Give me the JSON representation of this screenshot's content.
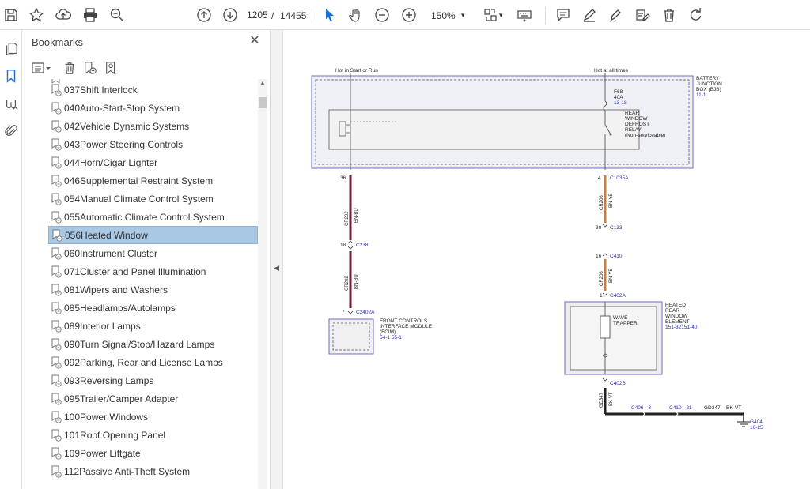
{
  "toolbar": {
    "page_current": "1205",
    "page_separator": "/",
    "page_total": "14455",
    "zoom": "150%",
    "accent_color": "#1a6fd4"
  },
  "rail_icons": [
    "pages-icon",
    "bookmark-icon",
    "attachments-link-icon",
    "paperclip-icon"
  ],
  "bookmarks": {
    "title": "Bookmarks",
    "selected_index": 8,
    "items": [
      {
        "label": "037Shift Interlock"
      },
      {
        "label": "040Auto-Start-Stop System"
      },
      {
        "label": "042Vehicle Dynamic Systems"
      },
      {
        "label": "043Power Steering Controls"
      },
      {
        "label": "044Horn/Cigar Lighter"
      },
      {
        "label": "046Supplemental Restraint System"
      },
      {
        "label": "054Manual Climate Control System"
      },
      {
        "label": "055Automatic Climate Control System"
      },
      {
        "label": "056Heated Window"
      },
      {
        "label": "060Instrument Cluster"
      },
      {
        "label": "071Cluster and Panel Illumination"
      },
      {
        "label": "081Wipers and Washers"
      },
      {
        "label": "085Headlamps/Autolamps"
      },
      {
        "label": "089Interior Lamps"
      },
      {
        "label": "090Turn Signal/Stop/Hazard Lamps"
      },
      {
        "label": "092Parking, Rear and License Lamps"
      },
      {
        "label": "093Reversing Lamps"
      },
      {
        "label": "095Trailer/Camper Adapter"
      },
      {
        "label": "100Power Windows"
      },
      {
        "label": "101Roof Opening Panel"
      },
      {
        "label": "109Power Liftgate"
      },
      {
        "label": "112Passive Anti-Theft System"
      }
    ]
  },
  "diagram": {
    "hot_start_run": "Hot in Start or Run",
    "hot_all_times": "Hot at all times",
    "bjb_l1": "BATTERY",
    "bjb_l2": "JUNCTION",
    "bjb_l3": "BOX (BJB)",
    "bjb_ref": "11-1",
    "fuse_name": "F68",
    "fuse_rating": "40A",
    "fuse_ref": "13-18",
    "relay_l1": "REAR",
    "relay_l2": "WINDOW",
    "relay_l3": "DEFROST",
    "relay_l4": "RELAY",
    "relay_l5": "(Non-serviceable)",
    "pin_36": "36",
    "pin_4": "4",
    "conn_c1035a": "C1035A",
    "wire_cr202_a": "CR202",
    "wire_bnbu_a": "BN-BU",
    "wire_cr206_a": "CR206",
    "wire_bnye_a": "BN-YE",
    "pin_30": "30",
    "conn_c133": "C133",
    "pin_18": "18",
    "conn_c238": "C238",
    "pin_16": "16",
    "conn_c410": "C410",
    "wire_cr202_b": "CR202",
    "wire_bnbu_b": "BN-BU",
    "wire_cr206_b": "CR206",
    "wire_bnye_b": "BN-YE",
    "pin_1": "1",
    "conn_c402a": "C402A",
    "pin_7": "7",
    "conn_c2402a": "C2402A",
    "fcim_l1": "FRONT CONTROLS",
    "fcim_l2": "INTERFACE MODULE",
    "fcim_l3": "(FCIM)",
    "fcim_ref": "54-1  55-1",
    "hrw_l1": "HEATED",
    "hrw_l2": "REAR",
    "hrw_l3": "WINDOW",
    "hrw_l4": "ELEMENT",
    "hrw_ref": "151-32151-40",
    "wave_l1": "WAVE",
    "wave_l2": "TRAPPER",
    "conn_c402b": "C402B",
    "wire_gd347": "GD347",
    "wire_bkvt": "BK-VT",
    "conn_c406": "C406 - 3",
    "conn_c410_21": "C410 - 21",
    "wire_gd347_b": "GD347",
    "wire_bkvt_b": "BK-VT",
    "ground_name": "G404",
    "ground_ref": "10-25"
  }
}
